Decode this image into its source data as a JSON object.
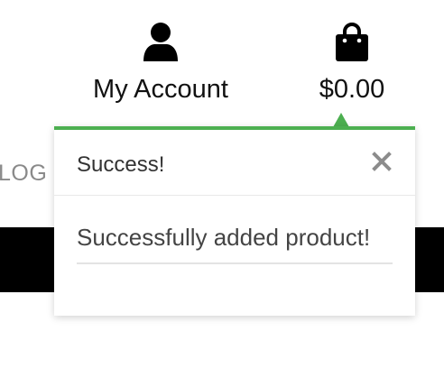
{
  "header": {
    "account": {
      "label": "My Account",
      "icon": "user-icon"
    },
    "cart": {
      "label": "$0.00",
      "icon": "shopping-bag-icon"
    }
  },
  "background": {
    "nav_fragment": "LOG"
  },
  "popup": {
    "title": "Success!",
    "message": "Successfully added product!",
    "close_icon": "close-icon",
    "accent_color": "#4caf50"
  }
}
